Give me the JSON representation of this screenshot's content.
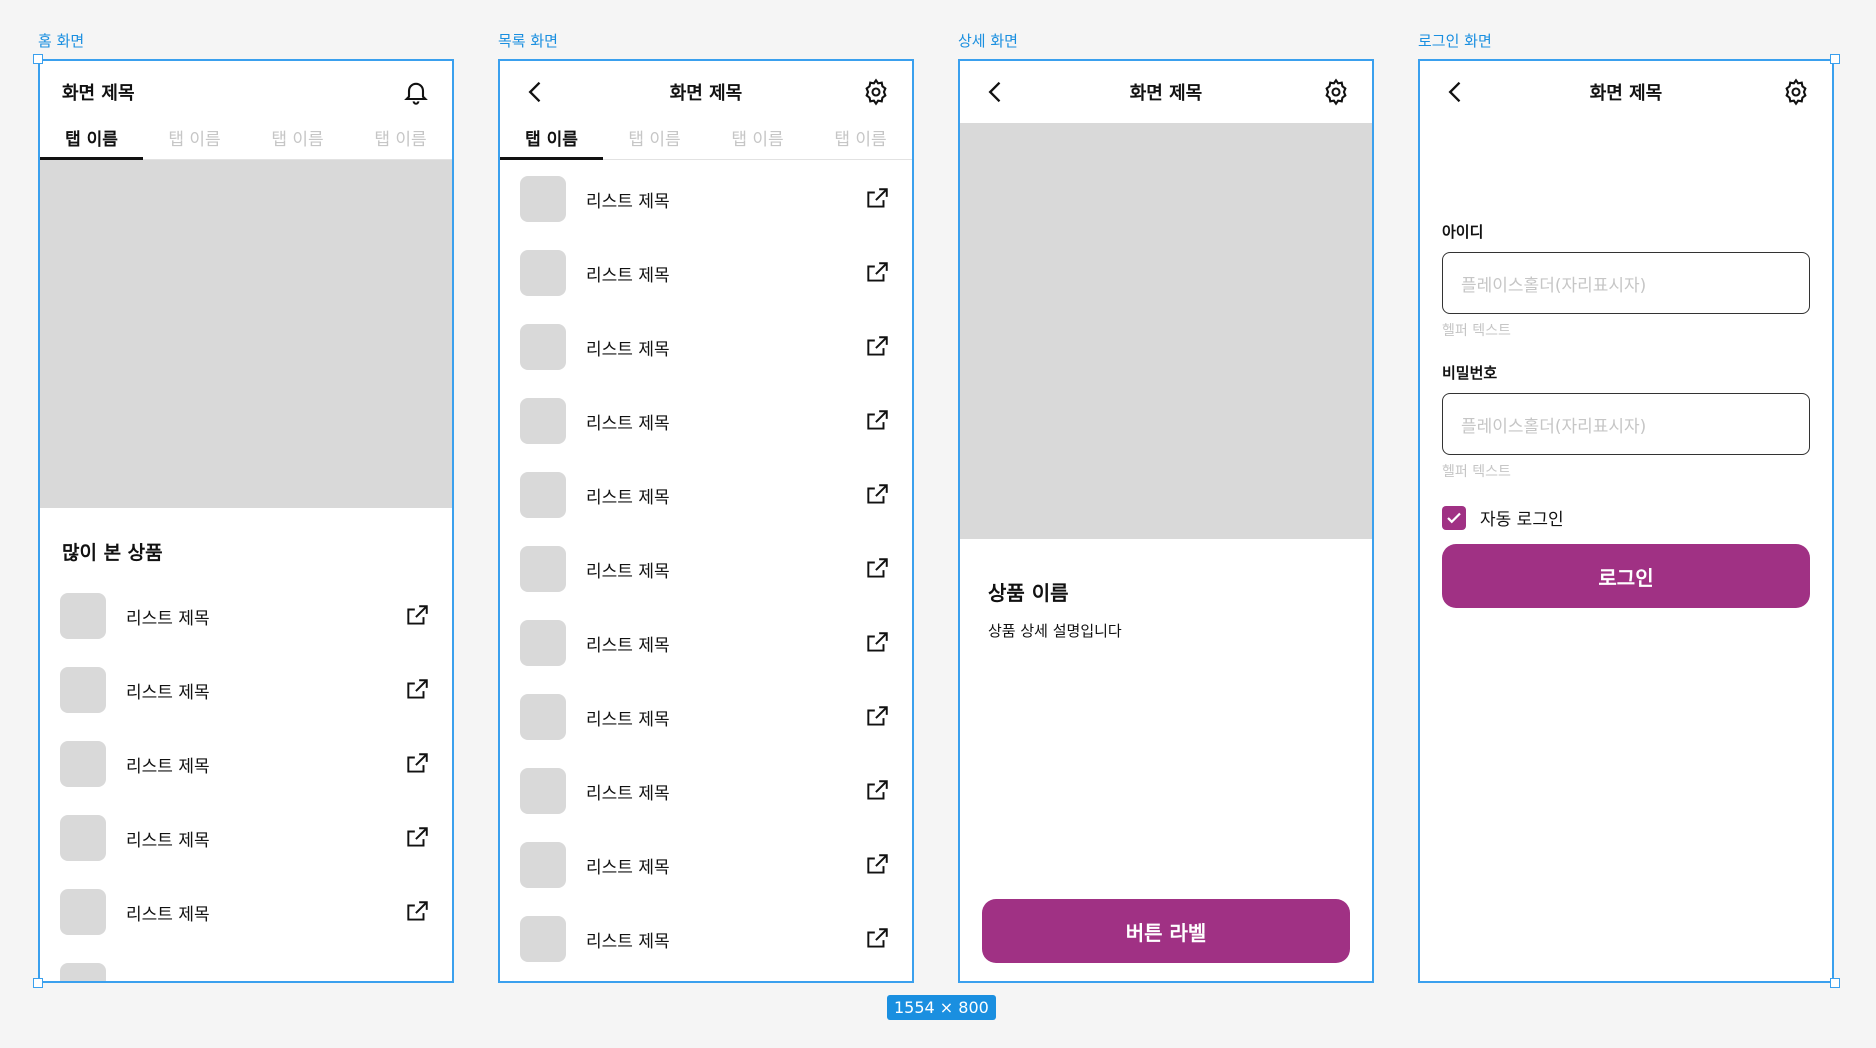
{
  "frames": [
    {
      "label": "홈 화면",
      "title": "화면 제목",
      "tabs": [
        "탭 이름",
        "탭 이름",
        "탭 이름",
        "탭 이름"
      ],
      "section_title": "많이 본 상품",
      "list_title": "리스트 제목"
    },
    {
      "label": "목록 화면",
      "title": "화면 제목",
      "tabs": [
        "탭 이름",
        "탭 이름",
        "탭 이름",
        "탭 이름"
      ],
      "list_title": "리스트 제목"
    },
    {
      "label": "상세 화면",
      "title": "화면 제목",
      "product_name": "상품 이름",
      "product_desc": "상품 상세 설명입니다",
      "button_label": "버튼 라벨"
    },
    {
      "label": "로그인 화면",
      "title": "화면 제목",
      "id_label": "아이디",
      "id_placeholder": "플레이스홀더(자리표시자)",
      "id_helper": "헬퍼 텍스트",
      "pw_label": "비밀번호",
      "pw_placeholder": "플레이스홀더(자리표시자)",
      "pw_helper": "헬퍼 텍스트",
      "auto_login": "자동 로그인",
      "login_button": "로그인"
    }
  ],
  "size_badge": "1554 × 800",
  "colors": {
    "accent": "#a03184",
    "selection": "#3aa0ee",
    "placeholder": "#d9d9d9"
  },
  "icons": [
    "bell-icon",
    "back-icon",
    "settings-icon",
    "external-link-icon",
    "check-icon"
  ]
}
